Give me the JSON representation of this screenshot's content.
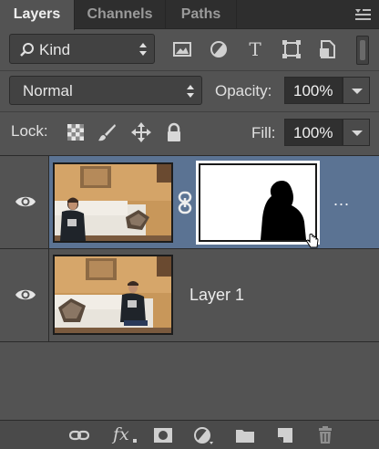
{
  "tabs": [
    {
      "label": "Layers",
      "active": true
    },
    {
      "label": "Channels",
      "active": false
    },
    {
      "label": "Paths",
      "active": false
    }
  ],
  "filter": {
    "kind_label": "Kind",
    "icons": [
      "image-filter-icon",
      "adjustment-filter-icon",
      "type-filter-icon",
      "shape-filter-icon",
      "smart-object-filter-icon"
    ]
  },
  "blend": {
    "mode": "Normal",
    "opacity_label": "Opacity:",
    "opacity_value": "100%"
  },
  "lock": {
    "label": "Lock:",
    "icons": [
      "lock-transparent-pixels-icon",
      "lock-image-pixels-icon",
      "lock-position-icon",
      "lock-all-icon"
    ],
    "fill_label": "Fill:",
    "fill_value": "100%"
  },
  "layers": [
    {
      "name": "",
      "visible": true,
      "selected": true,
      "has_mask": true,
      "extra": "..."
    },
    {
      "name": "Layer 1",
      "visible": true,
      "selected": false,
      "has_mask": false
    }
  ],
  "bottom_icons": [
    "link-layers-icon",
    "fx-icon",
    "add-mask-icon",
    "adjustment-layer-icon",
    "new-group-icon",
    "new-layer-icon",
    "delete-layer-icon"
  ],
  "bottom_fx_label": "fx",
  "colors": {
    "panel": "#535353",
    "selected_row": "#5b7393",
    "tabbar": "#2e2e2e"
  }
}
